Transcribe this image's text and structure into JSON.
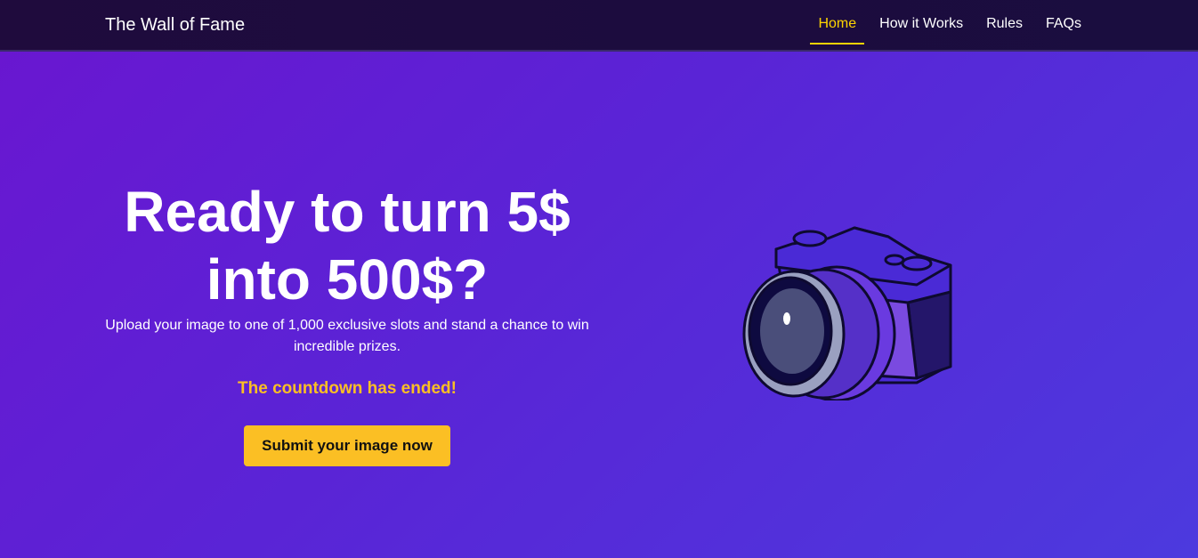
{
  "nav": {
    "brand": "The Wall of Fame",
    "links": [
      "Home",
      "How it Works",
      "Rules",
      "FAQs"
    ]
  },
  "hero": {
    "title": "Ready to turn 5$ into 500$?",
    "subtitle": "Upload your image to one of 1,000 exclusive slots and stand a chance to win incredible prizes.",
    "countdown": "The countdown has ended!",
    "cta": "Submit your image now"
  },
  "colors": {
    "accent": "#fbbf24",
    "nav_bg": "#1f0b3d"
  }
}
